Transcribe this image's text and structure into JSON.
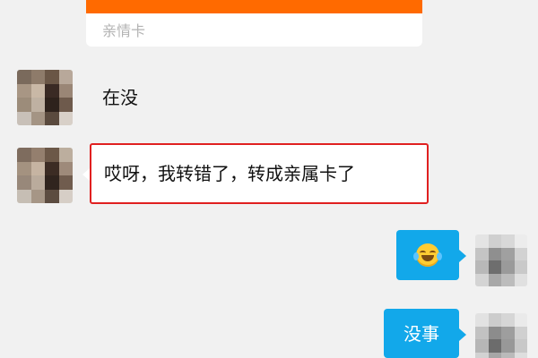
{
  "card": {
    "label": "亲情卡",
    "accent_color": "#ff6a00"
  },
  "messages": [
    {
      "side": "left",
      "text": "在没"
    },
    {
      "side": "left",
      "text": "哎呀，我转错了，转成亲属卡了",
      "highlighted": true
    },
    {
      "side": "right",
      "emoji": "face-with-tears-of-joy"
    },
    {
      "side": "right",
      "text": "没事"
    }
  ],
  "colors": {
    "background": "#f1f1f1",
    "outgoing_bubble": "#12a8ea",
    "incoming_bubble": "#ffffff",
    "highlight_border": "#e02020"
  }
}
